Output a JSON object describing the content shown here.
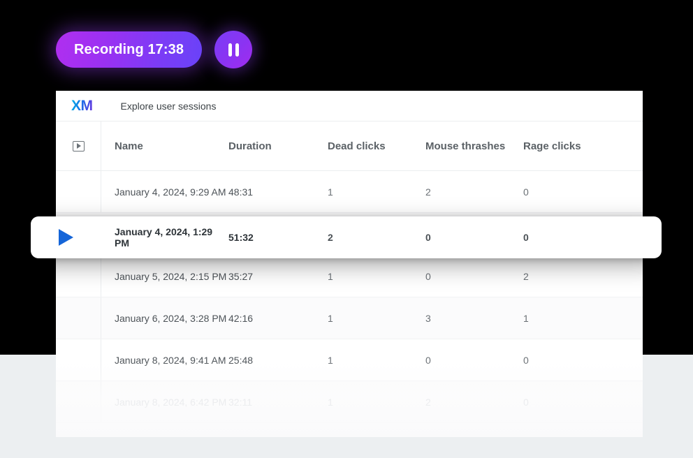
{
  "recording": {
    "label": "Recording 17:38",
    "pause_icon": "pause-icon",
    "badge_gradient_from": "#b02ff0",
    "badge_gradient_to": "#6a43f8"
  },
  "app": {
    "logo_text": "XM",
    "title": "Explore user sessions",
    "logo_gradient_from": "#00b4e6",
    "logo_gradient_to": "#6b2bdd"
  },
  "table": {
    "play_column_icon": "play-square-icon",
    "columns": {
      "name": "Name",
      "duration": "Duration",
      "dead_clicks": "Dead clicks",
      "mouse_thrashes": "Mouse thrashes",
      "rage_clicks": "Rage clicks"
    },
    "rows": [
      {
        "name": "January 4, 2024, 9:29 AM",
        "duration": "48:31",
        "dead_clicks": "1",
        "mouse_thrashes": "2",
        "rage_clicks": "0"
      },
      {
        "name": "January 5, 2024, 2:15 PM",
        "duration": "35:27",
        "dead_clicks": "1",
        "mouse_thrashes": "0",
        "rage_clicks": "2"
      },
      {
        "name": "January 6, 2024, 3:28 PM",
        "duration": "42:16",
        "dead_clicks": "1",
        "mouse_thrashes": "3",
        "rage_clicks": "1"
      },
      {
        "name": "January 8, 2024, 9:41 AM",
        "duration": "25:48",
        "dead_clicks": "1",
        "mouse_thrashes": "0",
        "rage_clicks": "0"
      },
      {
        "name": "January 8, 2024, 6:42 PM",
        "duration": "32:11",
        "dead_clicks": "1",
        "mouse_thrashes": "2",
        "rage_clicks": "0"
      }
    ],
    "selected_row": {
      "play_icon": "play-triangle-icon",
      "name": "January 4, 2024, 1:29 PM",
      "duration": "51:32",
      "dead_clicks": "2",
      "mouse_thrashes": "0",
      "rage_clicks": "0",
      "accent_color": "#1565d8"
    }
  }
}
